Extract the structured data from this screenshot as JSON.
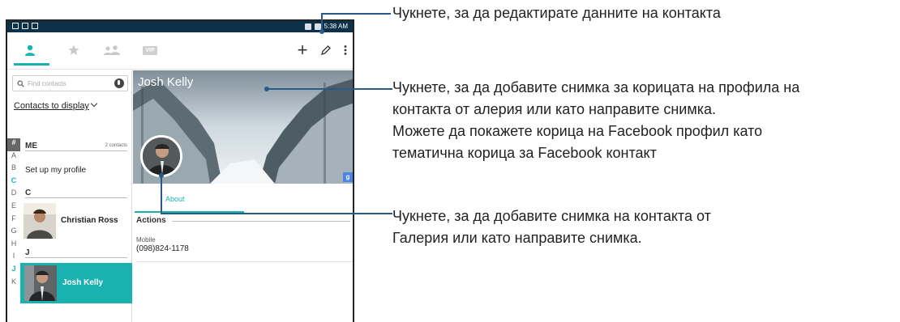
{
  "status_bar": {
    "time": "5:38 AM"
  },
  "toolbar": {
    "vip_label": "VIP",
    "add_label": "+"
  },
  "search": {
    "placeholder": "Find contacts"
  },
  "display_link": "Contacts to display",
  "index_letters": [
    "#",
    "A",
    "B",
    "C",
    "D",
    "E",
    "F",
    "G",
    "H",
    "I",
    "J",
    "K"
  ],
  "sections": {
    "me_label": "ME",
    "me_count": "2 contacts",
    "setup_profile": "Set up my profile",
    "c_label": "C",
    "j_label": "J"
  },
  "contacts": [
    {
      "name": "Christian Ross"
    },
    {
      "name": "Josh Kelly"
    }
  ],
  "detail": {
    "name": "Josh Kelly",
    "tab_about": "About",
    "actions_title": "Actions",
    "mobile_label": "Mobile",
    "mobile_number": "(098)824-1178",
    "gplus_glyph": "g"
  },
  "callouts": {
    "edit": "Чукнете, за да редактирате данните на контакта",
    "cover_lines": [
      "Чукнете, за да добавите снимка за корицата на профила на",
      "контакта от алерия или като направите снимка.",
      "Можете да покажете корица на Facebook профил като",
      "тематична корица за Facebook контакт"
    ],
    "photo_lines": [
      "Чукнете, за да добавите снимка на контакта от",
      "Галерия или като направите снимка."
    ]
  },
  "colors": {
    "accent": "#19b2b0",
    "status_bar": "#0d3149",
    "callout": "#2a5a8a"
  }
}
